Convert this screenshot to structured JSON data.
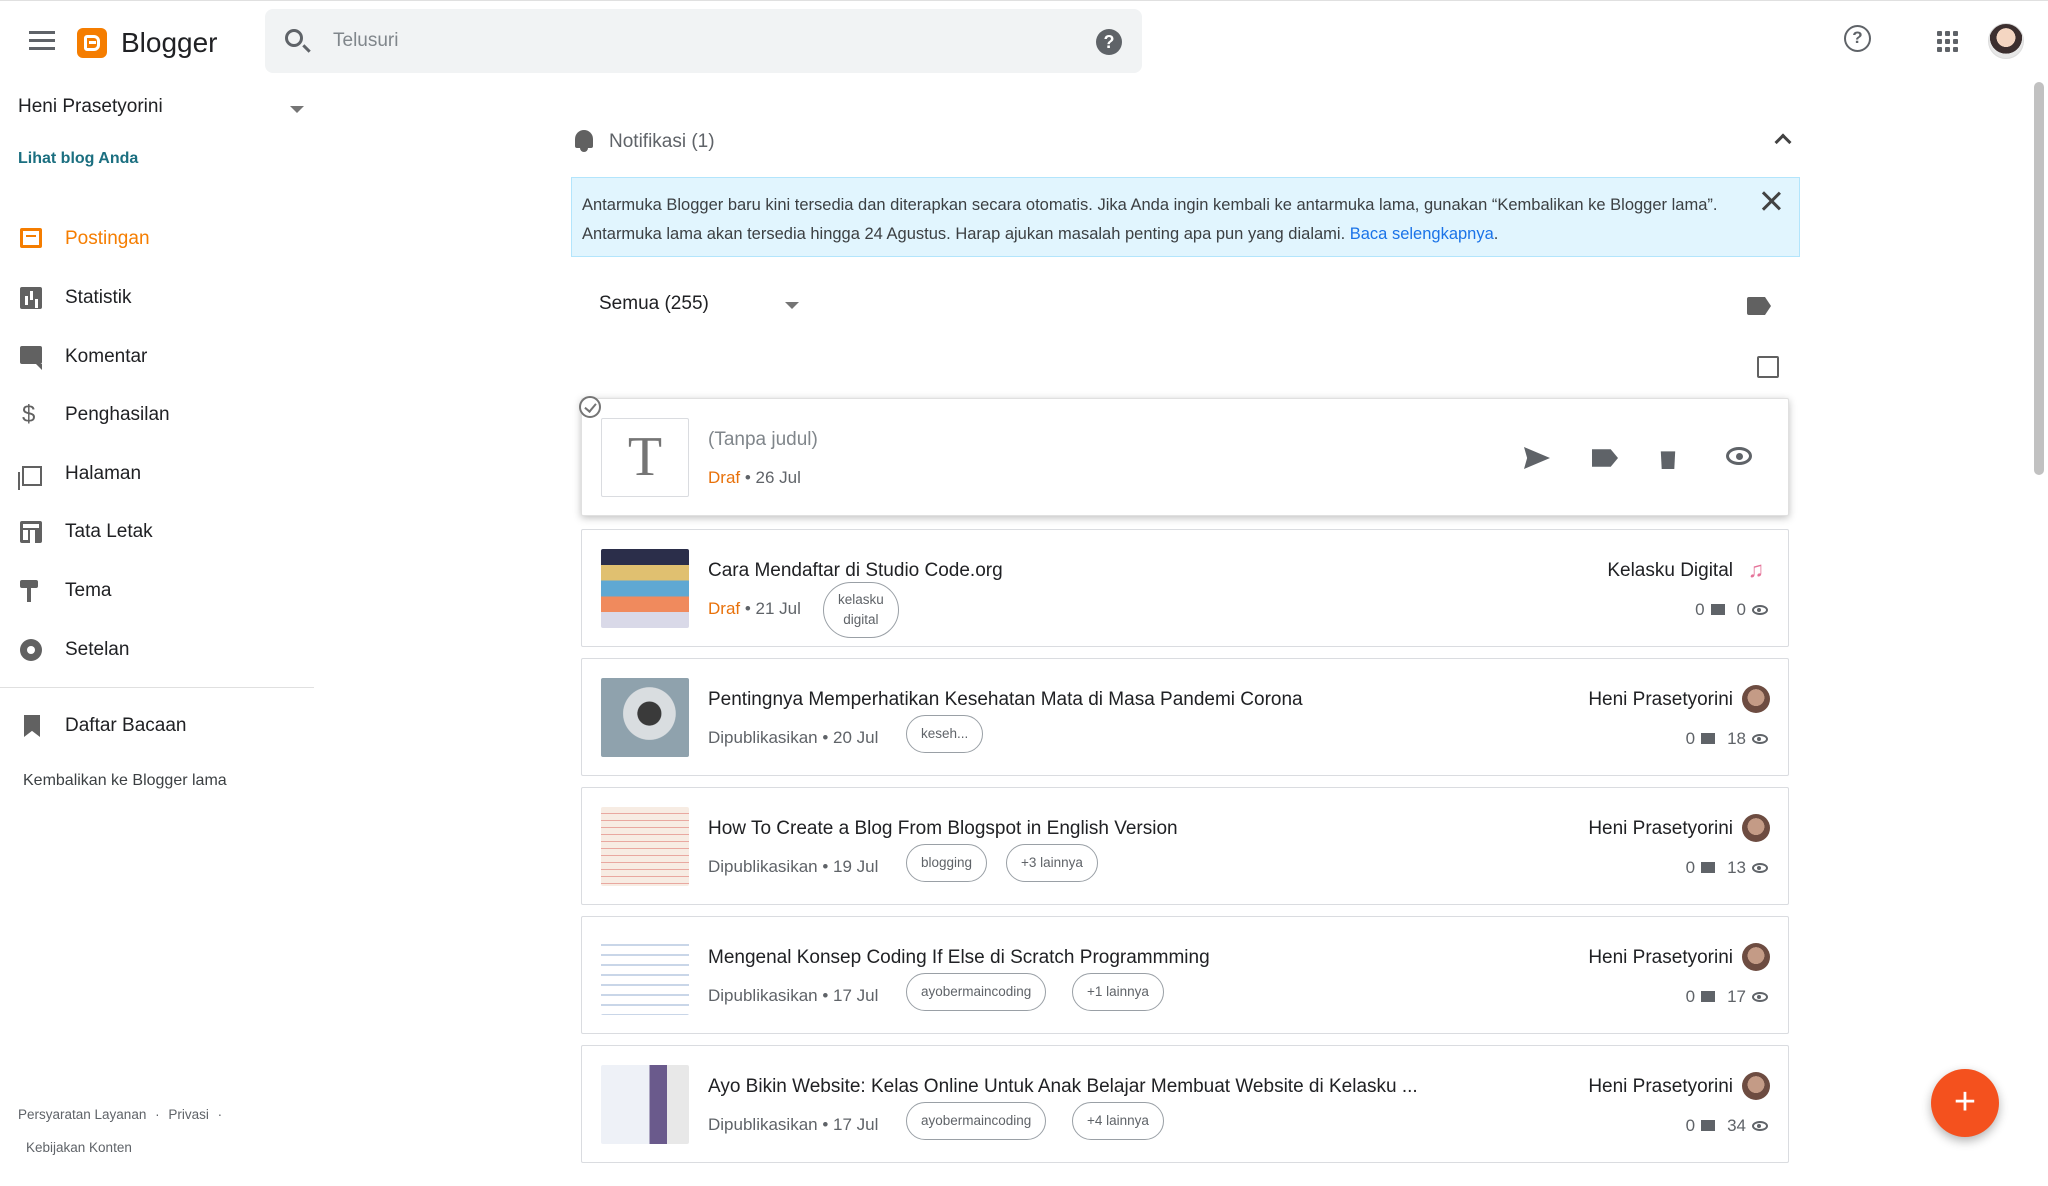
{
  "app": {
    "brand": "Blogger"
  },
  "search": {
    "placeholder": "Telusuri"
  },
  "sidebar": {
    "blog_name": "Heni Prasetyorini",
    "view_blog": "Lihat blog Anda",
    "items": [
      {
        "label": "Postingan",
        "icon": "posts-icon",
        "active": true
      },
      {
        "label": "Statistik",
        "icon": "stats-icon"
      },
      {
        "label": "Komentar",
        "icon": "comment-icon"
      },
      {
        "label": "Penghasilan",
        "icon": "dollar-icon"
      },
      {
        "label": "Halaman",
        "icon": "pages-icon"
      },
      {
        "label": "Tata Letak",
        "icon": "layout-icon"
      },
      {
        "label": "Tema",
        "icon": "paint-brush-icon"
      },
      {
        "label": "Setelan",
        "icon": "gear-icon"
      },
      {
        "label": "Daftar Bacaan",
        "icon": "bookmark-icon"
      }
    ],
    "revert": "Kembalikan ke Blogger lama",
    "footer": {
      "terms": "Persyaratan Layanan",
      "privacy": "Privasi",
      "content_policy": "Kebijakan Konten",
      "sep": "·"
    }
  },
  "notifications": {
    "title": "Notifikasi (1)",
    "message": "Antarmuka Blogger baru kini tersedia dan diterapkan secara otomatis. Jika Anda ingin kembali ke antarmuka lama, gunakan “Kembalikan ke Blogger lama”. Antarmuka lama akan tersedia hingga 24 Agustus. Harap ajukan masalah penting apa pun yang dialami. ",
    "link": "Baca selengkapnya",
    "period": "."
  },
  "filter": {
    "label": "Semua (255)"
  },
  "posts": [
    {
      "title": "(Tanpa judul)",
      "status": "Draf",
      "date": "• 26 Jul",
      "thumb_letter": "T"
    },
    {
      "title": "Cara Mendaftar di Studio Code.org",
      "status": "Draf",
      "date": "• 21 Jul",
      "labels": [
        "kelasku",
        "digital"
      ],
      "author": "Kelasku Digital",
      "comments": "0",
      "views": "0"
    },
    {
      "title": "Pentingnya Memperhatikan Kesehatan Mata di Masa Pandemi Corona",
      "status": "Dipublikasikan",
      "date": "• 20 Jul",
      "labels": [
        "keseh..."
      ],
      "author": "Heni Prasetyorini",
      "comments": "0",
      "views": "18"
    },
    {
      "title": "How To Create a Blog From Blogspot in English Version",
      "status": "Dipublikasikan",
      "date": "• 19 Jul",
      "labels": [
        "blogging",
        "+3 lainnya"
      ],
      "author": "Heni Prasetyorini",
      "comments": "0",
      "views": "13"
    },
    {
      "title": "Mengenal Konsep Coding If Else di Scratch Programmming",
      "status": "Dipublikasikan",
      "date": "• 17 Jul",
      "labels": [
        "ayobermaincoding",
        "+1 lainnya"
      ],
      "author": "Heni Prasetyorini",
      "comments": "0",
      "views": "17"
    },
    {
      "title": "Ayo Bikin Website: Kelas Online Untuk Anak Belajar Membuat Website di Kelasku ...",
      "status": "Dipublikasikan",
      "date": "• 17 Jul",
      "labels": [
        "ayobermaincoding",
        "+4 lainnya"
      ],
      "author": "Heni Prasetyorini",
      "comments": "0",
      "views": "34"
    }
  ],
  "colors": {
    "accent": "#f57d00",
    "fab": "#f4511e",
    "banner": "#e1f5fe",
    "link": "#1a73e8"
  },
  "fab": {
    "symbol": "+"
  }
}
